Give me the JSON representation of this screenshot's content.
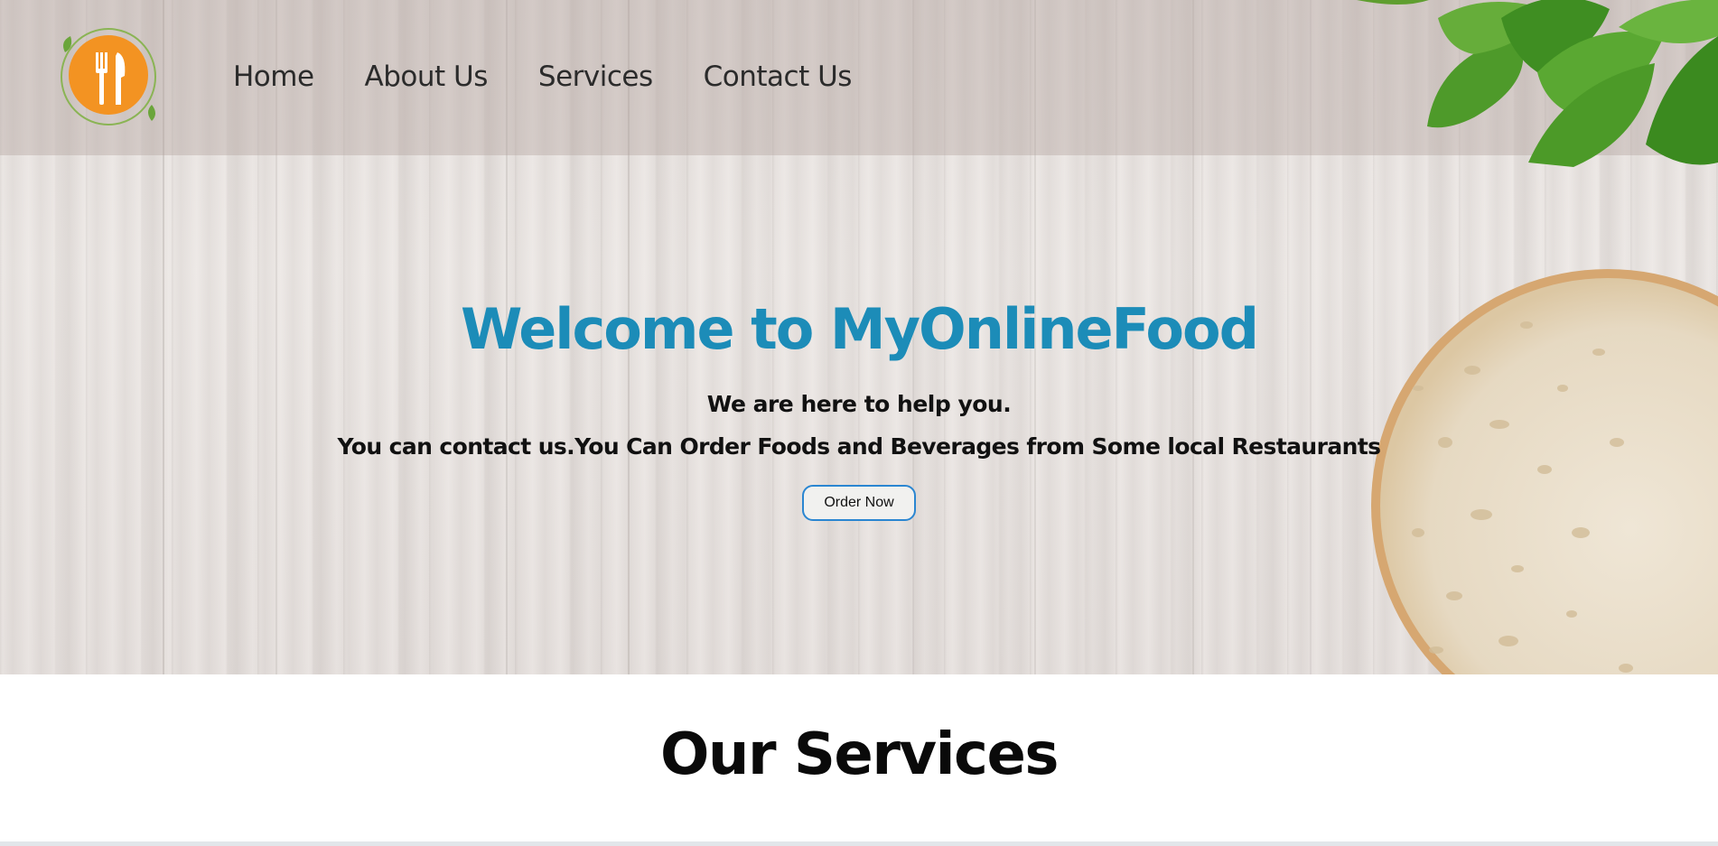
{
  "nav": {
    "home": "Home",
    "about": "About Us",
    "services": "Services",
    "contact": "Contact Us"
  },
  "hero": {
    "title": "Welcome to MyOnlineFood",
    "subtitle_line1": "We are here to help you.",
    "subtitle_line2": "You can contact us.You Can Order Foods and Beverages from Some local Restaurants",
    "button_label": "Order Now"
  },
  "services": {
    "heading": "Our Services"
  },
  "icons": {
    "logo": "fork-knife-plate-icon"
  },
  "colors": {
    "title": "#1c8cb8",
    "logo_orange": "#f39322",
    "leaf_green": "#6aa53a",
    "button_border": "#2a86d1"
  }
}
